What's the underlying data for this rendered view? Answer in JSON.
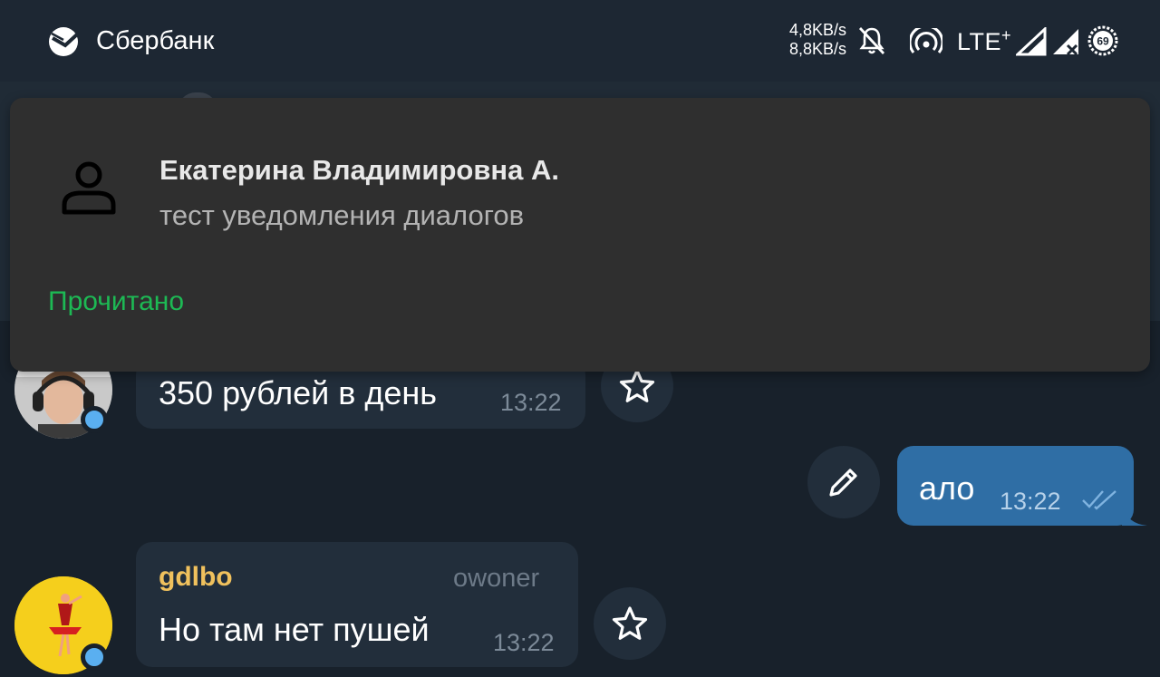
{
  "status_bar": {
    "app_name": "Сбербанк",
    "upload_speed": "4,8KB/s",
    "download_speed": "8,8KB/s",
    "network": "LTE",
    "network_suffix": "+",
    "battery": "69",
    "icons": [
      "sberbank-logo-icon",
      "bell-off-icon",
      "hotspot-icon",
      "signal-icon",
      "signal-no-data-icon",
      "battery-icon"
    ]
  },
  "notification": {
    "sender": "Екатерина Владимировна А.",
    "text": "тест уведомления диалогов",
    "action_label": "Прочитано",
    "avatar_icon": "person-icon"
  },
  "messages": [
    {
      "direction": "incoming",
      "text": "350 рублей в день",
      "time": "13:22",
      "side_button_icon": "star-icon"
    },
    {
      "direction": "outgoing",
      "text": "ало",
      "time": "13:22",
      "status_icon": "double-check-icon",
      "side_button_icon": "pencil-icon"
    },
    {
      "direction": "incoming",
      "sender": "gdlbo",
      "sender_role": "owoner",
      "text": "Но там нет пушей",
      "time": "13:22",
      "side_button_icon": "star-icon"
    }
  ],
  "colors": {
    "background": "#18212b",
    "incoming_bubble": "#222e3b",
    "outgoing_bubble": "#2f6ea5",
    "notification_bg": "#2f2f2f",
    "action_green": "#1db954",
    "sender_name": "#f0c15d",
    "online_dot": "#5aaff0"
  }
}
